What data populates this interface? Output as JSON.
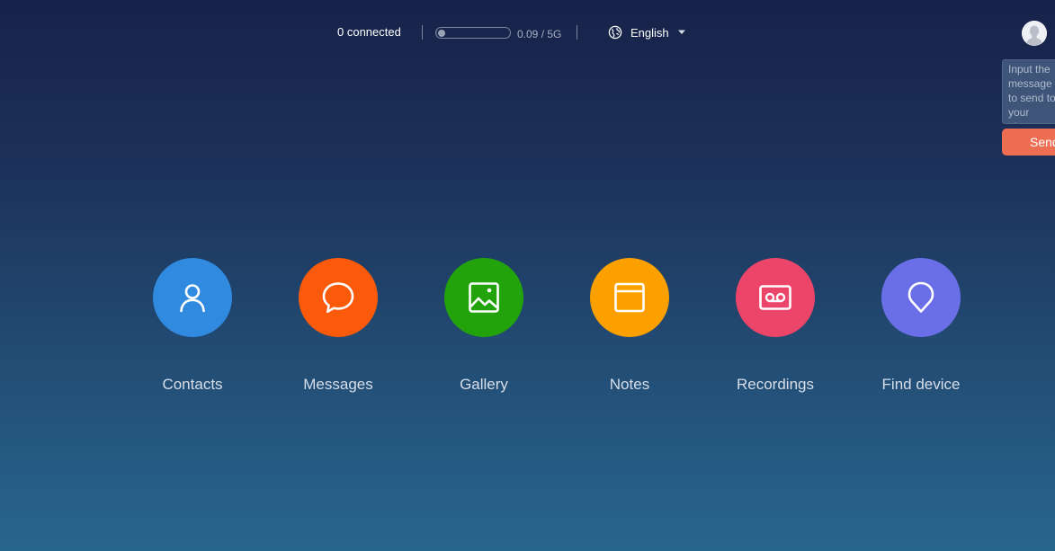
{
  "header": {
    "connected_text": "0 connected",
    "storage": {
      "text": "0.09 / 5G",
      "used": 0.09,
      "total": 5
    },
    "language": {
      "label": "English",
      "icon": "globe-icon",
      "dropdown_icon": "caret-down-icon"
    },
    "avatar_icon": "user-avatar-icon"
  },
  "feedback": {
    "placeholder": "Input the message to send to your phone",
    "send_label": "Send"
  },
  "apps": [
    {
      "label": "Contacts",
      "icon": "contacts-icon",
      "color": "#2f8ae0"
    },
    {
      "label": "Messages",
      "icon": "messages-icon",
      "color": "#fa5a0a"
    },
    {
      "label": "Gallery",
      "icon": "gallery-icon",
      "color": "#23a30b"
    },
    {
      "label": "Notes",
      "icon": "notes-icon",
      "color": "#fca000"
    },
    {
      "label": "Recordings",
      "icon": "recordings-icon",
      "color": "#eb4669"
    },
    {
      "label": "Find device",
      "icon": "find-device-icon",
      "color": "#6a6fe8"
    }
  ],
  "colors": {
    "background_top": "#17224a",
    "background_bottom": "#27668d",
    "send_button": "#ee6e53"
  }
}
